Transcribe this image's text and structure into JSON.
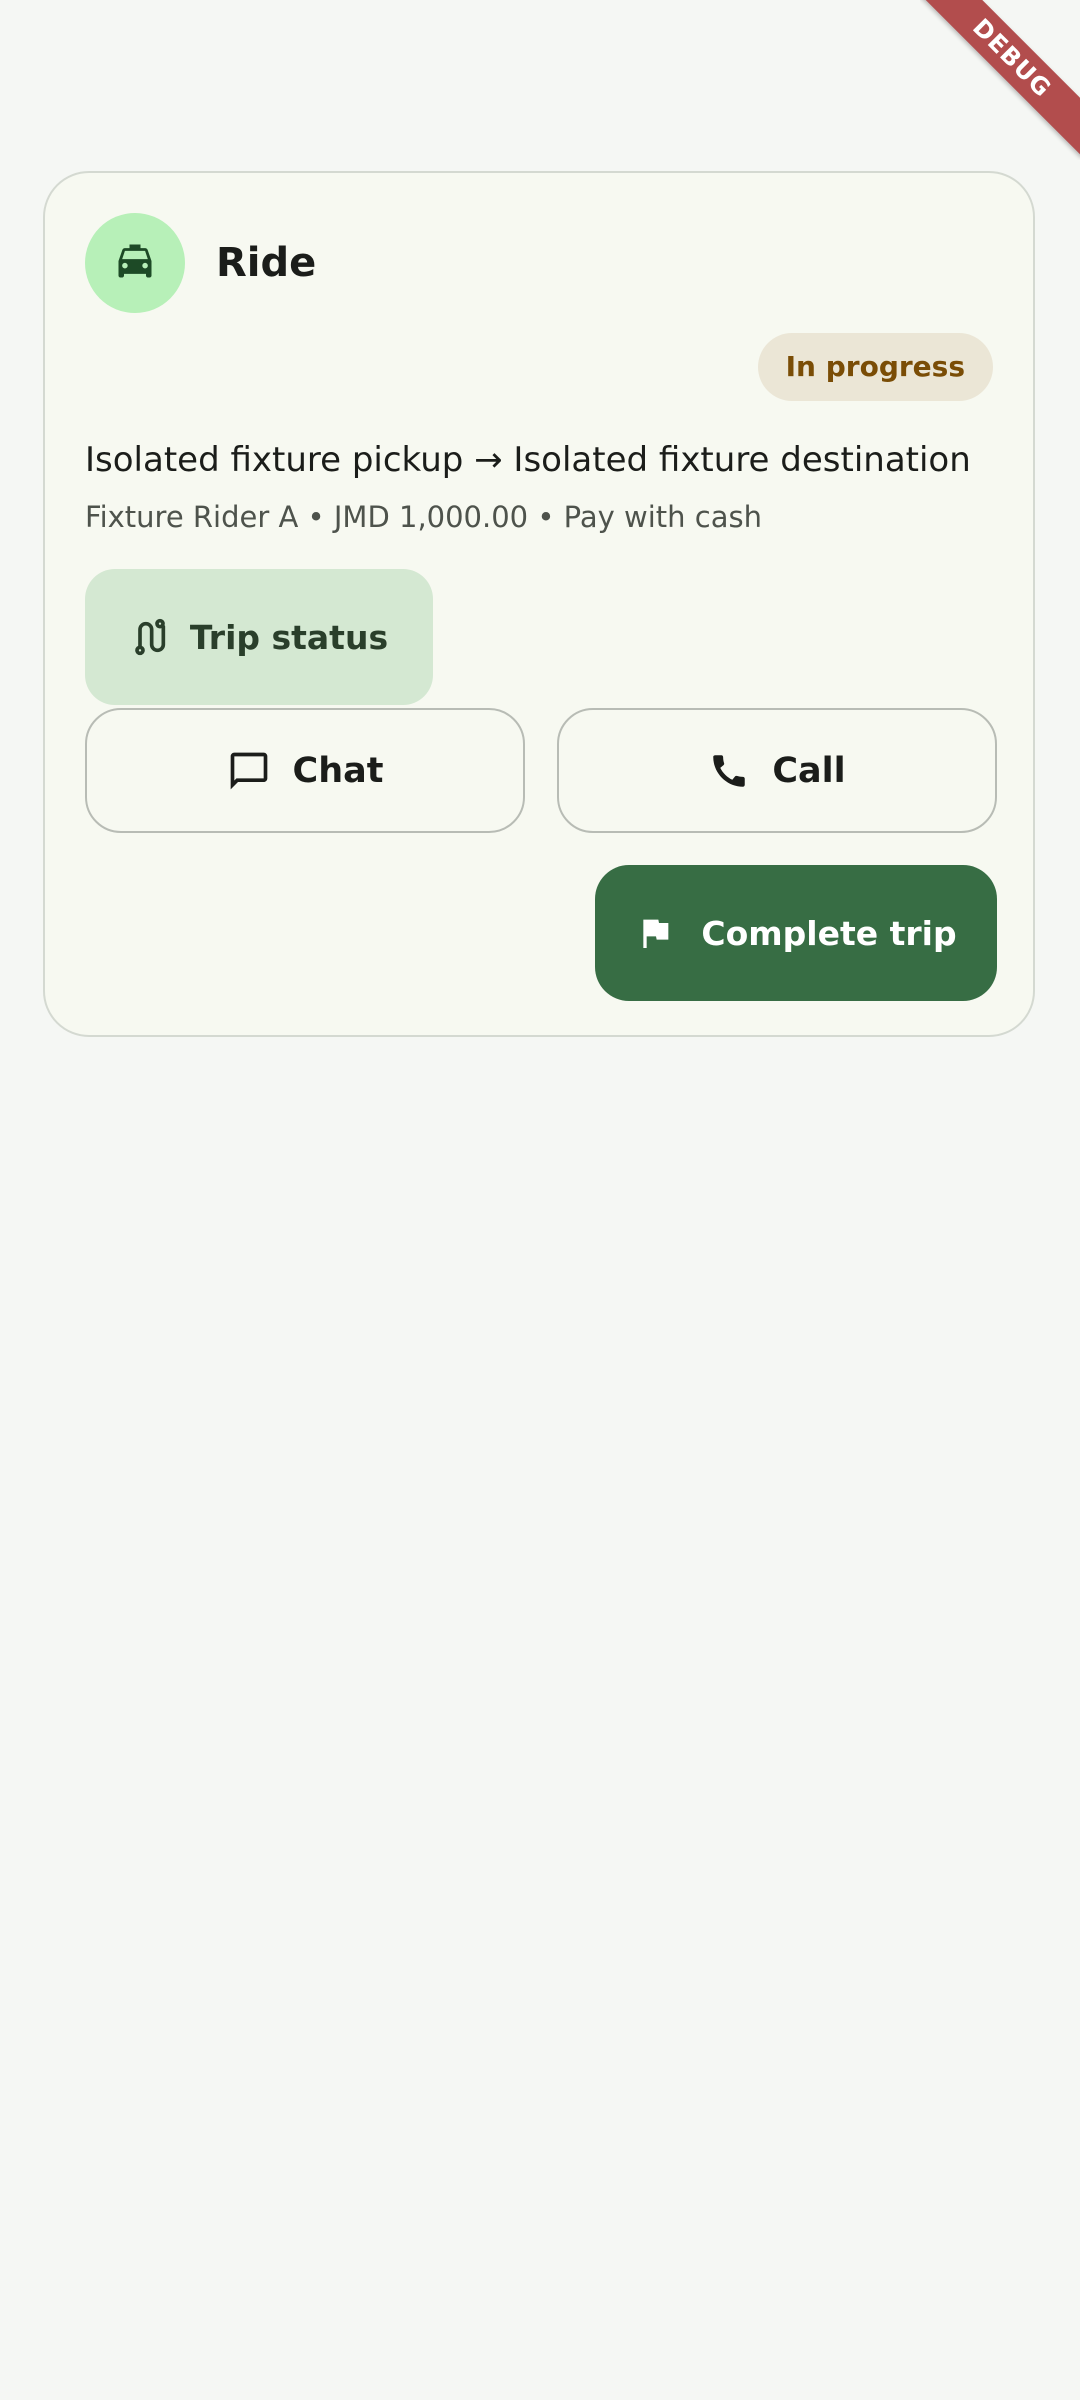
{
  "debug_banner": {
    "label": "DEBUG"
  },
  "ride_card": {
    "title": "Ride",
    "title_icon": "taxi-icon",
    "status": "In progress",
    "route": "Isolated fixture pickup → Isolated fixture destination",
    "meta": "Fixture Rider A • JMD 1,000.00 • Pay with cash",
    "actions": {
      "trip_status": {
        "label": "Trip status",
        "icon": "route-icon"
      },
      "chat": {
        "label": "Chat",
        "icon": "chat-bubble-icon"
      },
      "call": {
        "label": "Call",
        "icon": "phone-icon"
      },
      "complete": {
        "label": "Complete trip",
        "icon": "flag-icon"
      }
    }
  },
  "colors": {
    "background": "#f5f7f4",
    "card_background": "#f7f9f1",
    "avatar_background": "#b7f0b8",
    "status_pill_background": "#ebe6d6",
    "status_pill_text": "#7a4d06",
    "tonal_button_background": "#d4e8d2",
    "primary_button_background": "#376d44",
    "primary_button_text": "#ffffff",
    "debug_ribbon": "#b24d4d"
  }
}
